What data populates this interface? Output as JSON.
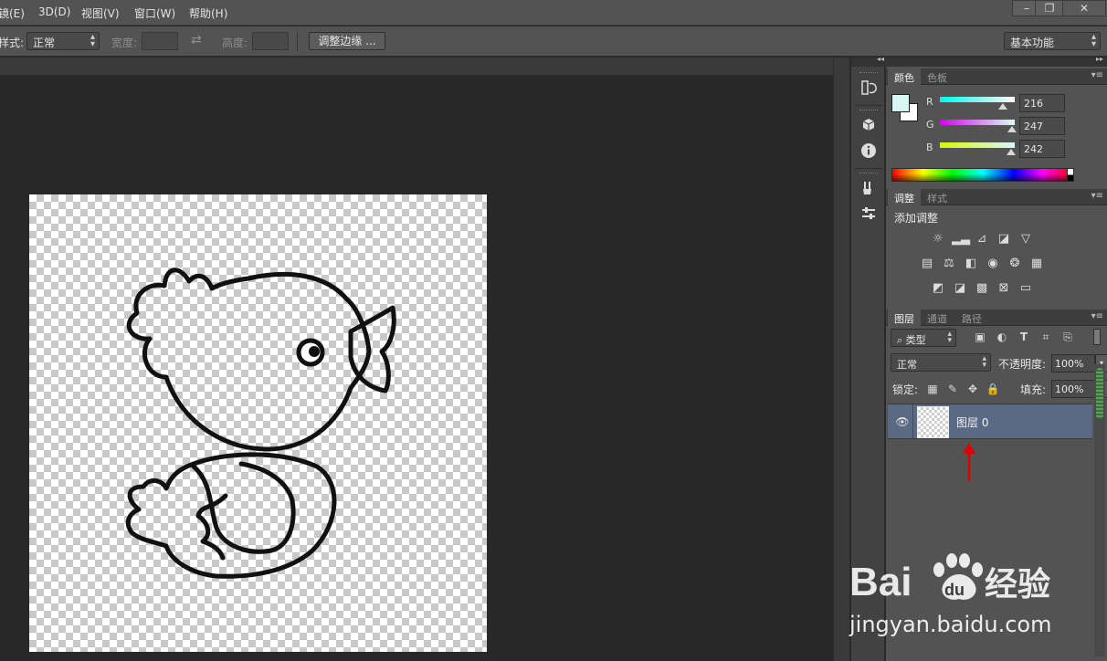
{
  "menubar": {
    "items": [
      "编辑(E)",
      "3D(D)",
      "视图(V)",
      "窗口(W)",
      "帮助(H)"
    ],
    "edit_visible": "镜(E)"
  },
  "window_controls": {
    "minimize": "–",
    "restore": "❐",
    "close": "✕"
  },
  "options": {
    "style_label": "样式:",
    "style_value": "正常",
    "width_label": "宽度:",
    "swap_icon": "⇄",
    "height_label": "高度:",
    "refine_button": "调整边缘 ...",
    "workspace_value": "基本功能"
  },
  "color_panel": {
    "tabs": [
      "颜色",
      "色板"
    ],
    "foreground": "#d8f7f2",
    "background": "#ffffff",
    "channels": [
      {
        "label": "R",
        "value": "216",
        "fraction": 0.847
      },
      {
        "label": "G",
        "value": "247",
        "fraction": 0.969
      },
      {
        "label": "B",
        "value": "242",
        "fraction": 0.949
      }
    ]
  },
  "adjustments_panel": {
    "tabs": [
      "调整",
      "样式"
    ],
    "title": "添加调整"
  },
  "layers_panel": {
    "tabs": [
      "图层",
      "通道",
      "路径"
    ],
    "filter_value": "类型",
    "blend_mode": "正常",
    "opacity_label": "不透明度:",
    "opacity_value": "100%",
    "lock_label": "锁定:",
    "fill_label": "填充:",
    "fill_value": "100%",
    "layer_name": "图层 0"
  },
  "watermark": {
    "brand_left": "Bai",
    "brand_mid": "du",
    "brand_right": "经验",
    "url": "jingyan.baidu.com"
  },
  "colors": {
    "accent_arrow": "#e00000",
    "selected_layer": "#5a6a84"
  },
  "icons": {
    "dock": [
      "history-icon",
      "3d-icon",
      "info-icon",
      "brush-icon",
      "properties-icon"
    ],
    "layer_filters": [
      "image-filter-icon",
      "adjustment-filter-icon",
      "type-filter-icon",
      "shape-filter-icon",
      "smart-filter-icon"
    ],
    "locks": [
      "lock-transparent-icon",
      "lock-paint-icon",
      "lock-position-icon",
      "lock-all-icon"
    ]
  }
}
